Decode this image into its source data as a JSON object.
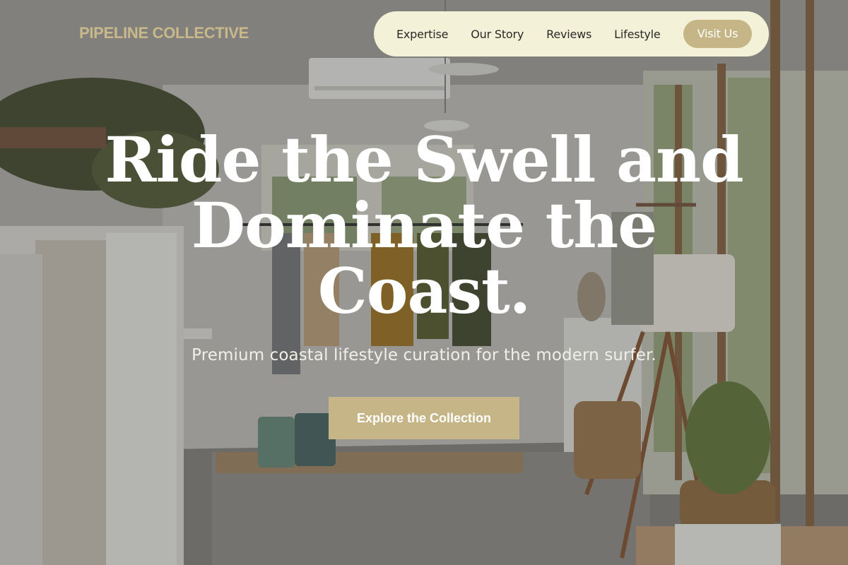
{
  "header": {
    "brand": "PIPELINE COLLECTIVE",
    "nav": [
      {
        "label": "Expertise"
      },
      {
        "label": "Our Story"
      },
      {
        "label": "Reviews"
      },
      {
        "label": "Lifestyle"
      }
    ],
    "visit_label": "Visit Us"
  },
  "hero": {
    "headline_lines": [
      "Ride the Swell and",
      "Dominate the",
      "Coast."
    ],
    "subtitle": "Premium coastal lifestyle curation for the modern surfer.",
    "cta_label": "Explore the Collection",
    "background_image": "boutique-interior-photo"
  },
  "colors": {
    "accent": "#c6b587",
    "brand": "#c9b88a",
    "nav_bg": "#f3f1d8",
    "headline": "#ffffff"
  }
}
